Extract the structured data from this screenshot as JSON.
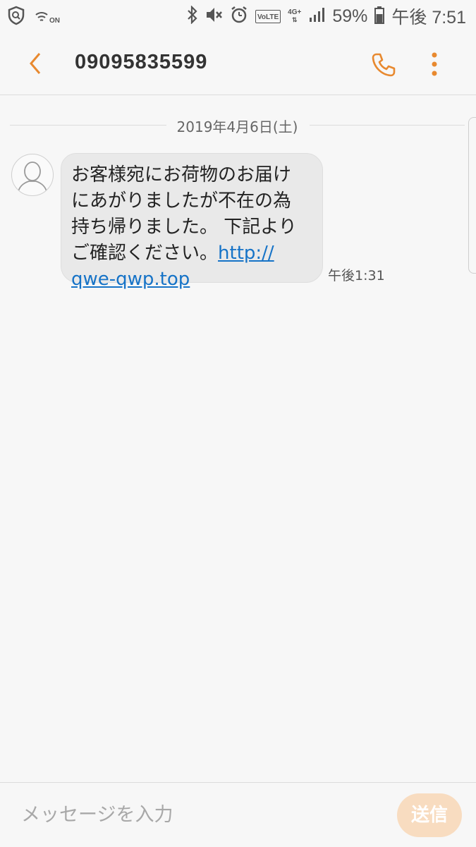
{
  "status_bar": {
    "battery_percent": "59%",
    "time": "午後 7:51",
    "network": "4G+",
    "volte": "VoLTE",
    "nfc": "ON",
    "icons": [
      "shield-search-icon",
      "nfc-icon",
      "bluetooth-icon",
      "mute-icon",
      "alarm-icon",
      "volte-icon",
      "network-icon",
      "signal-icon",
      "battery-icon"
    ]
  },
  "header": {
    "title": "09095835599",
    "accent_color": "#e8892f"
  },
  "conversation": {
    "date": "2019年4月6日(土)",
    "messages": [
      {
        "text_lines": [
          "お客様宛にお荷物のお届け",
          "にあがりましたが不在の為",
          "持ち帰りました。 下記より",
          "ご確認ください。"
        ],
        "link_part1": "http://",
        "link_part2": "qwe-qwp.top",
        "time": "午後1:31"
      }
    ]
  },
  "composer": {
    "placeholder": "メッセージを入力",
    "send_label": "送信"
  }
}
